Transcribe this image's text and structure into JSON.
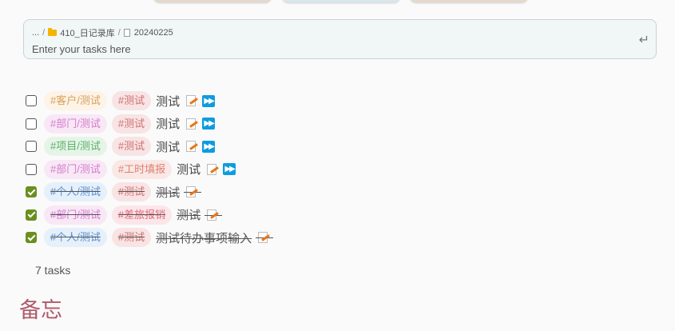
{
  "breadcrumb": {
    "ellipsis": "...",
    "separator": "/",
    "folder": "410_日记录库",
    "file": "20240225"
  },
  "task_input": {
    "placeholder": "Enter your tasks here",
    "value": ""
  },
  "enter_icon": "enter-icon",
  "tasks": [
    {
      "checked": false,
      "tags": [
        {
          "text": "#客户/测试",
          "style": "c-kehu"
        },
        {
          "text": "#测试",
          "style": "c-test"
        }
      ],
      "text": "测试",
      "forward": true
    },
    {
      "checked": false,
      "tags": [
        {
          "text": "#部门/测试",
          "style": "c-bumen"
        },
        {
          "text": "#测试",
          "style": "c-test"
        }
      ],
      "text": "测试",
      "forward": true
    },
    {
      "checked": false,
      "tags": [
        {
          "text": "#项目/测试",
          "style": "c-xiangmu"
        },
        {
          "text": "#测试",
          "style": "c-test"
        }
      ],
      "text": "测试",
      "forward": true
    },
    {
      "checked": false,
      "tags": [
        {
          "text": "#部门/测试",
          "style": "c-bumen"
        },
        {
          "text": "#工时填报",
          "style": "c-gongshi"
        }
      ],
      "text": "测试",
      "forward": true
    },
    {
      "checked": true,
      "tags": [
        {
          "text": "#个人/测试",
          "style": "c-geren"
        },
        {
          "text": "#测试",
          "style": "c-test"
        }
      ],
      "text": "测试",
      "forward": false
    },
    {
      "checked": true,
      "tags": [
        {
          "text": "#部门/测试",
          "style": "c-bumen"
        },
        {
          "text": "#差旅报销",
          "style": "c-chailv"
        }
      ],
      "text": "测试",
      "forward": false
    },
    {
      "checked": true,
      "tags": [
        {
          "text": "#个人/测试",
          "style": "c-geren"
        },
        {
          "text": "#测试",
          "style": "c-test"
        }
      ],
      "text": "测试待办事项输入",
      "forward": false
    }
  ],
  "task_count": "7 tasks",
  "section_heading": "备忘",
  "colors": {
    "checked": "#6a8f1e",
    "forward_button": "#0f9be0",
    "heading": "#b05a6a"
  }
}
